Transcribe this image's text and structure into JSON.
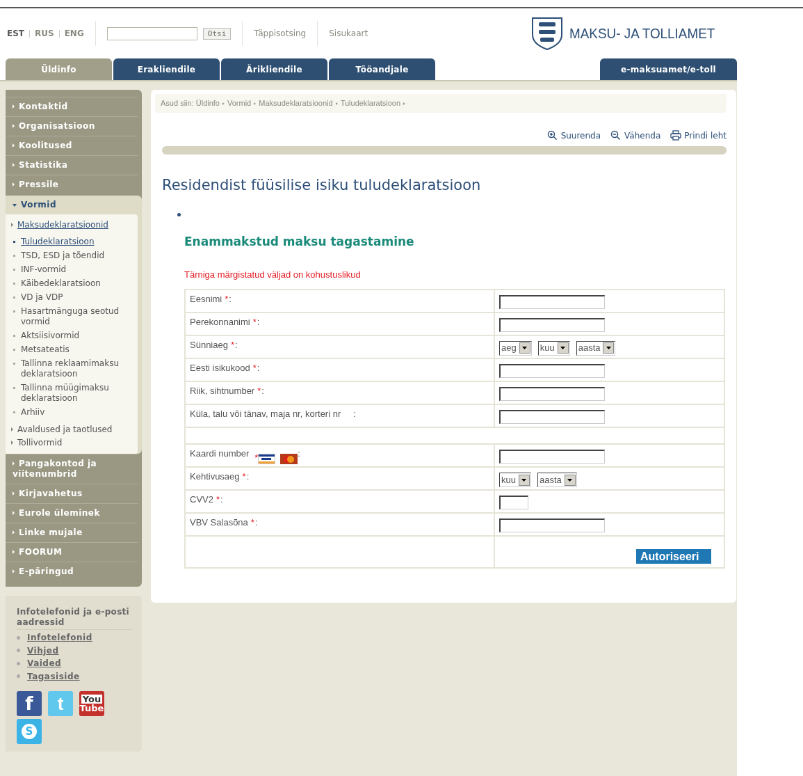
{
  "languages": [
    {
      "label": "EST",
      "selected": true
    },
    {
      "label": "RUS",
      "selected": false
    },
    {
      "label": "ENG",
      "selected": false
    }
  ],
  "search": {
    "button": "Otsi"
  },
  "header_links": [
    "Täppisotsing",
    "Sisukaart"
  ],
  "logo": {
    "text": "MAKSU- JA TOLLIAMET"
  },
  "tabs": [
    {
      "label": "Üldinfo",
      "selected": true
    },
    {
      "label": "Erakliendile",
      "selected": false
    },
    {
      "label": "Ärikliendile",
      "selected": false
    },
    {
      "label": "Tööandjale",
      "selected": false
    }
  ],
  "tab_right": {
    "label": "e-maksuamet/e-toll",
    "selected": false
  },
  "sidebar": {
    "items": [
      {
        "label": "Kontaktid",
        "expanded": false
      },
      {
        "label": "Organisatsioon",
        "expanded": false
      },
      {
        "label": "Koolitused",
        "expanded": false
      },
      {
        "label": "Statistika",
        "expanded": false
      },
      {
        "label": "Pressile",
        "expanded": false
      },
      {
        "label": "Vormid",
        "expanded": true,
        "children": [
          {
            "label": "Maksudeklaratsioonid",
            "selected": true,
            "children": [
              {
                "label": "Tuludeklaratsioon",
                "selected": true
              },
              {
                "label": "TSD, ESD ja tõendid",
                "selected": false
              },
              {
                "label": "INF-vormid",
                "selected": false
              },
              {
                "label": "Käibedeklaratsioon",
                "selected": false
              },
              {
                "label": "VD ja VDP",
                "selected": false
              },
              {
                "label": "Hasartmänguga seotud vormid",
                "selected": false
              },
              {
                "label": "Aktsiisivormid",
                "selected": false
              },
              {
                "label": "Metsateatis",
                "selected": false
              },
              {
                "label": "Tallinna reklaamimaksu deklaratsioon",
                "selected": false
              },
              {
                "label": "Tallinna müügimaksu deklaratsioon",
                "selected": false
              },
              {
                "label": "Arhiiv",
                "selected": false
              }
            ]
          },
          {
            "label": "Avaldused ja taotlused",
            "selected": false
          },
          {
            "label": "Tollivormid",
            "selected": false
          }
        ]
      },
      {
        "label": "Pangakontod ja viitenumbrid",
        "expanded": false
      },
      {
        "label": "Kirjavahetus",
        "expanded": false
      },
      {
        "label": "Eurole üleminek",
        "expanded": false
      },
      {
        "label": "Linke mujale",
        "expanded": false
      },
      {
        "label": "FOORUM",
        "expanded": false
      },
      {
        "label": "E-päringud",
        "expanded": false
      }
    ]
  },
  "info_box": {
    "title": "Infotelefonid ja e-posti aadressid",
    "links": [
      "Infotelefonid",
      "Vihjed",
      "Vaided",
      "Tagasiside"
    ]
  },
  "social": [
    {
      "kind": "facebook",
      "lines": [
        "f"
      ]
    },
    {
      "kind": "twitter",
      "lines": [
        "t"
      ]
    },
    {
      "kind": "youtube",
      "lines": [
        "You",
        "Tube"
      ]
    },
    {
      "kind": "skype",
      "lines": [
        "S"
      ]
    }
  ],
  "breadcrumb": {
    "prefix": "Asud siin:",
    "items": [
      "Üldinfo",
      "Vormid",
      "Maksudeklaratsioonid",
      "Tuludeklaratsioon"
    ]
  },
  "tools": [
    {
      "kind": "zoom-in",
      "label": "Suurenda"
    },
    {
      "kind": "zoom-out",
      "label": "Vähenda"
    },
    {
      "kind": "print",
      "label": "Prindi leht"
    }
  ],
  "title": "Residendist füüsilise isiku tuludeklaratsioon",
  "subtitle": "Enammakstud maksu tagastamine",
  "required_note": "Tärniga märgistatud väljad on kohustuslikud",
  "form": {
    "rows": [
      {
        "kind": "text",
        "label": "Eesnimi",
        "mark": "*",
        "colon": ":"
      },
      {
        "kind": "text",
        "label": "Perekonnanimi",
        "mark": "*",
        "colon": ":"
      },
      {
        "kind": "selects",
        "label": "Sünniaeg",
        "mark": "*",
        "colon": ":",
        "selects": [
          "aeg",
          "kuu",
          "aasta"
        ]
      },
      {
        "kind": "text",
        "label": "Eesti isikukood",
        "mark": "*",
        "colon": ":"
      },
      {
        "kind": "text",
        "label": "Riik, sihtnumber",
        "mark": "*",
        "colon": ":"
      },
      {
        "kind": "text",
        "label": "Küla, talu või tänav, maja nr, korteri nr",
        "colon": ":"
      },
      {
        "kind": "spacer"
      },
      {
        "kind": "card",
        "label": "Kaardi number",
        "mark": "*",
        "colon": ":"
      },
      {
        "kind": "selects",
        "label": "Kehtivusaeg",
        "mark": "*",
        "colon": ":",
        "selects": [
          "kuu",
          "aasta"
        ]
      },
      {
        "kind": "short",
        "label": "CVV2",
        "mark": "*",
        "colon": ":"
      },
      {
        "kind": "text",
        "label": "VBV Salasõna",
        "mark": "*",
        "colon": ":"
      },
      {
        "kind": "button",
        "button": "Autoriseeri"
      }
    ]
  }
}
